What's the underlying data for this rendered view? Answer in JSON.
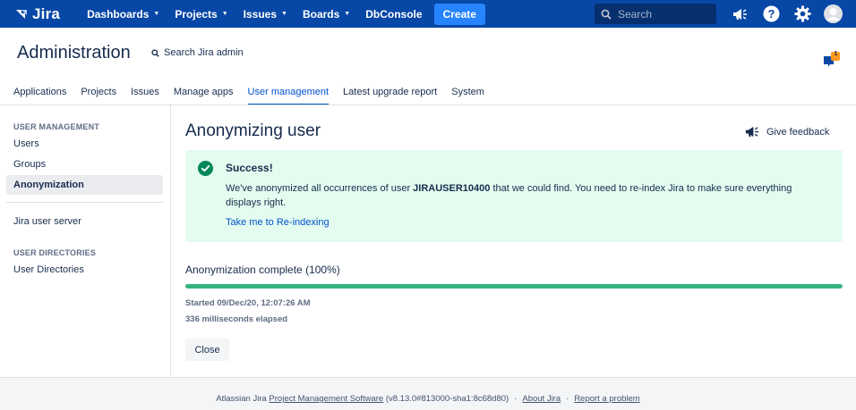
{
  "colors": {
    "topnav_bg": "#0747a6",
    "create_bg": "#2684ff",
    "link": "#0052cc",
    "success_bg": "#e3fcef",
    "success_icon": "#00875a",
    "progress": "#36b37e"
  },
  "topnav": {
    "logo_text": "Jira",
    "items": [
      {
        "label": "Dashboards",
        "has_dropdown": true
      },
      {
        "label": "Projects",
        "has_dropdown": true
      },
      {
        "label": "Issues",
        "has_dropdown": true
      },
      {
        "label": "Boards",
        "has_dropdown": true
      },
      {
        "label": "DbConsole",
        "has_dropdown": false
      }
    ],
    "create_label": "Create",
    "search_placeholder": "Search",
    "icons": [
      "megaphone-icon",
      "help-icon",
      "settings-icon",
      "avatar-icon"
    ]
  },
  "admin": {
    "title": "Administration",
    "search_label": "Search Jira admin",
    "notification_count": "1"
  },
  "tabs": [
    {
      "label": "Applications",
      "active": false
    },
    {
      "label": "Projects",
      "active": false
    },
    {
      "label": "Issues",
      "active": false
    },
    {
      "label": "Manage apps",
      "active": false
    },
    {
      "label": "User management",
      "active": true
    },
    {
      "label": "Latest upgrade report",
      "active": false
    },
    {
      "label": "System",
      "active": false
    }
  ],
  "sidebar": {
    "heading_user_management": "USER MANAGEMENT",
    "items": [
      {
        "label": "Users",
        "selected": false
      },
      {
        "label": "Groups",
        "selected": false
      },
      {
        "label": "Anonymization",
        "selected": true
      }
    ],
    "jira_user_server": "Jira user server",
    "heading_user_directories": "USER DIRECTORIES",
    "user_directories": "User Directories"
  },
  "main": {
    "title": "Anonymizing user",
    "feedback_label": "Give feedback",
    "success": {
      "title": "Success!",
      "body_before": "We've anonymized all occurrences of user ",
      "username": "JIRAUSER10400",
      "body_after": " that we could find. You need to re-index Jira to make sure everything displays right.",
      "link": "Take me to Re-indexing"
    },
    "progress": {
      "title": "Anonymization complete (100%)",
      "percent": 100
    },
    "started": "Started 09/Dec/20, 12:07:26 AM",
    "elapsed": "336 milliseconds elapsed",
    "close_label": "Close"
  },
  "footer": {
    "prefix": "Atlassian Jira ",
    "product_link": "Project Management Software",
    "version": " (v8.13.0#813000-sha1:8c68d80)",
    "about": "About Jira",
    "report": "Report a problem",
    "separator": "·"
  }
}
